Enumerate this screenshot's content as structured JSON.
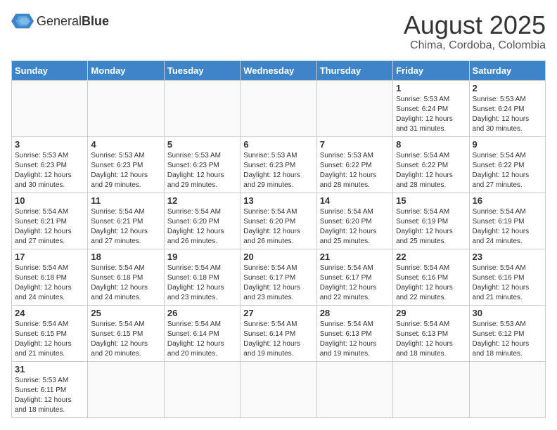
{
  "header": {
    "logo_text_regular": "General",
    "logo_text_bold": "Blue",
    "month_title": "August 2025",
    "location": "Chima, Cordoba, Colombia"
  },
  "weekdays": [
    "Sunday",
    "Monday",
    "Tuesday",
    "Wednesday",
    "Thursday",
    "Friday",
    "Saturday"
  ],
  "weeks": [
    [
      {
        "day": "",
        "info": ""
      },
      {
        "day": "",
        "info": ""
      },
      {
        "day": "",
        "info": ""
      },
      {
        "day": "",
        "info": ""
      },
      {
        "day": "",
        "info": ""
      },
      {
        "day": "1",
        "info": "Sunrise: 5:53 AM\nSunset: 6:24 PM\nDaylight: 12 hours\nand 31 minutes."
      },
      {
        "day": "2",
        "info": "Sunrise: 5:53 AM\nSunset: 6:24 PM\nDaylight: 12 hours\nand 30 minutes."
      }
    ],
    [
      {
        "day": "3",
        "info": "Sunrise: 5:53 AM\nSunset: 6:23 PM\nDaylight: 12 hours\nand 30 minutes."
      },
      {
        "day": "4",
        "info": "Sunrise: 5:53 AM\nSunset: 6:23 PM\nDaylight: 12 hours\nand 29 minutes."
      },
      {
        "day": "5",
        "info": "Sunrise: 5:53 AM\nSunset: 6:23 PM\nDaylight: 12 hours\nand 29 minutes."
      },
      {
        "day": "6",
        "info": "Sunrise: 5:53 AM\nSunset: 6:23 PM\nDaylight: 12 hours\nand 29 minutes."
      },
      {
        "day": "7",
        "info": "Sunrise: 5:53 AM\nSunset: 6:22 PM\nDaylight: 12 hours\nand 28 minutes."
      },
      {
        "day": "8",
        "info": "Sunrise: 5:54 AM\nSunset: 6:22 PM\nDaylight: 12 hours\nand 28 minutes."
      },
      {
        "day": "9",
        "info": "Sunrise: 5:54 AM\nSunset: 6:22 PM\nDaylight: 12 hours\nand 27 minutes."
      }
    ],
    [
      {
        "day": "10",
        "info": "Sunrise: 5:54 AM\nSunset: 6:21 PM\nDaylight: 12 hours\nand 27 minutes."
      },
      {
        "day": "11",
        "info": "Sunrise: 5:54 AM\nSunset: 6:21 PM\nDaylight: 12 hours\nand 27 minutes."
      },
      {
        "day": "12",
        "info": "Sunrise: 5:54 AM\nSunset: 6:20 PM\nDaylight: 12 hours\nand 26 minutes."
      },
      {
        "day": "13",
        "info": "Sunrise: 5:54 AM\nSunset: 6:20 PM\nDaylight: 12 hours\nand 26 minutes."
      },
      {
        "day": "14",
        "info": "Sunrise: 5:54 AM\nSunset: 6:20 PM\nDaylight: 12 hours\nand 25 minutes."
      },
      {
        "day": "15",
        "info": "Sunrise: 5:54 AM\nSunset: 6:19 PM\nDaylight: 12 hours\nand 25 minutes."
      },
      {
        "day": "16",
        "info": "Sunrise: 5:54 AM\nSunset: 6:19 PM\nDaylight: 12 hours\nand 24 minutes."
      }
    ],
    [
      {
        "day": "17",
        "info": "Sunrise: 5:54 AM\nSunset: 6:18 PM\nDaylight: 12 hours\nand 24 minutes."
      },
      {
        "day": "18",
        "info": "Sunrise: 5:54 AM\nSunset: 6:18 PM\nDaylight: 12 hours\nand 24 minutes."
      },
      {
        "day": "19",
        "info": "Sunrise: 5:54 AM\nSunset: 6:18 PM\nDaylight: 12 hours\nand 23 minutes."
      },
      {
        "day": "20",
        "info": "Sunrise: 5:54 AM\nSunset: 6:17 PM\nDaylight: 12 hours\nand 23 minutes."
      },
      {
        "day": "21",
        "info": "Sunrise: 5:54 AM\nSunset: 6:17 PM\nDaylight: 12 hours\nand 22 minutes."
      },
      {
        "day": "22",
        "info": "Sunrise: 5:54 AM\nSunset: 6:16 PM\nDaylight: 12 hours\nand 22 minutes."
      },
      {
        "day": "23",
        "info": "Sunrise: 5:54 AM\nSunset: 6:16 PM\nDaylight: 12 hours\nand 21 minutes."
      }
    ],
    [
      {
        "day": "24",
        "info": "Sunrise: 5:54 AM\nSunset: 6:15 PM\nDaylight: 12 hours\nand 21 minutes."
      },
      {
        "day": "25",
        "info": "Sunrise: 5:54 AM\nSunset: 6:15 PM\nDaylight: 12 hours\nand 20 minutes."
      },
      {
        "day": "26",
        "info": "Sunrise: 5:54 AM\nSunset: 6:14 PM\nDaylight: 12 hours\nand 20 minutes."
      },
      {
        "day": "27",
        "info": "Sunrise: 5:54 AM\nSunset: 6:14 PM\nDaylight: 12 hours\nand 19 minutes."
      },
      {
        "day": "28",
        "info": "Sunrise: 5:54 AM\nSunset: 6:13 PM\nDaylight: 12 hours\nand 19 minutes."
      },
      {
        "day": "29",
        "info": "Sunrise: 5:54 AM\nSunset: 6:13 PM\nDaylight: 12 hours\nand 18 minutes."
      },
      {
        "day": "30",
        "info": "Sunrise: 5:53 AM\nSunset: 6:12 PM\nDaylight: 12 hours\nand 18 minutes."
      }
    ],
    [
      {
        "day": "31",
        "info": "Sunrise: 5:53 AM\nSunset: 6:11 PM\nDaylight: 12 hours\nand 18 minutes."
      },
      {
        "day": "",
        "info": ""
      },
      {
        "day": "",
        "info": ""
      },
      {
        "day": "",
        "info": ""
      },
      {
        "day": "",
        "info": ""
      },
      {
        "day": "",
        "info": ""
      },
      {
        "day": "",
        "info": ""
      }
    ]
  ]
}
